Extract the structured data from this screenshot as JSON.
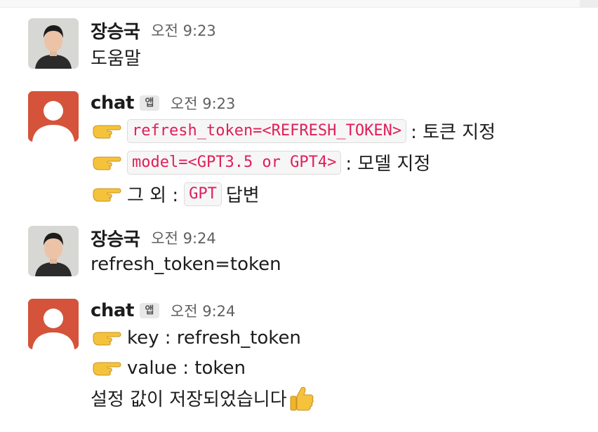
{
  "messages": [
    {
      "sender": "장승국",
      "is_app": false,
      "time": "오전 9:23",
      "lines": [
        {
          "text": "도움말"
        }
      ]
    },
    {
      "sender": "chat",
      "is_app": true,
      "app_badge": "앱",
      "time": "오전 9:23",
      "lines": [
        {
          "emoji": "pointing-right-icon",
          "code": "refresh_token=<REFRESH_TOKEN>",
          "suffix": ": 토큰 지정"
        },
        {
          "emoji": "pointing-right-icon",
          "code": "model=<GPT3.5 or GPT4>",
          "suffix": ": 모델 지정"
        },
        {
          "emoji": "pointing-right-icon",
          "prefix": "그 외 :",
          "code": "GPT",
          "suffix": "답변"
        }
      ]
    },
    {
      "sender": "장승국",
      "is_app": false,
      "time": "오전 9:24",
      "lines": [
        {
          "text": "refresh_token=token"
        }
      ]
    },
    {
      "sender": "chat",
      "is_app": true,
      "app_badge": "앱",
      "time": "오전 9:24",
      "lines": [
        {
          "emoji": "pointing-right-icon",
          "text": "key : refresh_token"
        },
        {
          "emoji": "pointing-right-icon",
          "text": "value : token"
        },
        {
          "text": "설정 값이 저장되었습니다",
          "trailing_emoji": "thumbs-up-icon"
        }
      ]
    }
  ],
  "colors": {
    "code_text": "#e01e5a",
    "code_bg": "#f6f6f6",
    "default_avatar": "#d4533a",
    "timestamp": "#616061"
  }
}
